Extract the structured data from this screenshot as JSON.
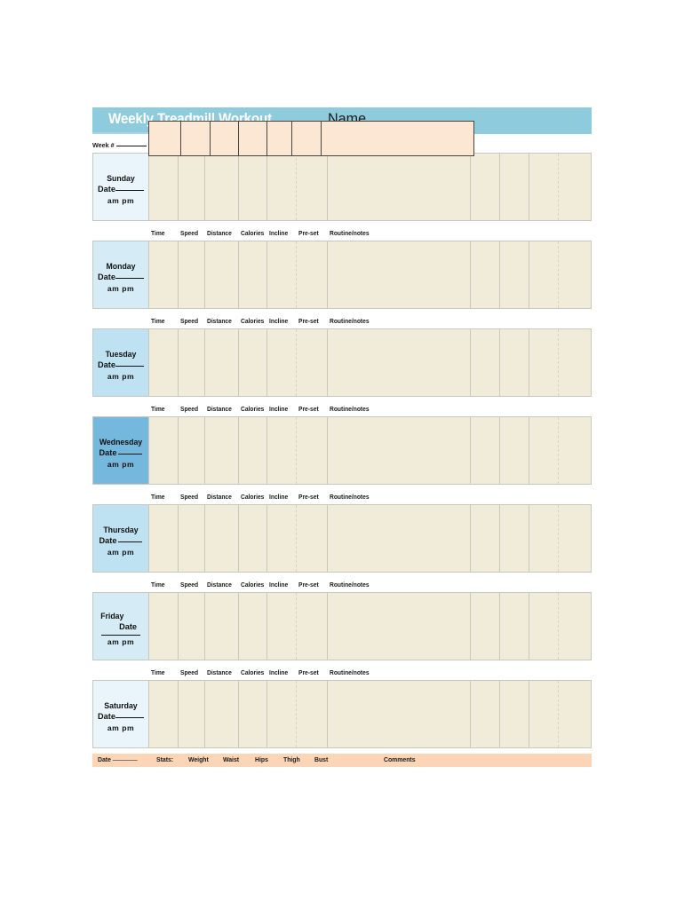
{
  "header": {
    "title": "Weekly Treadmill Workout",
    "name_label": "Name",
    "week_label": "Week #"
  },
  "columns": {
    "time": "Time",
    "speed": "Speed",
    "distance": "Distance",
    "calories": "Calories",
    "incline": "Incline",
    "preset": "Pre-set",
    "routine": "Routine/notes"
  },
  "day_common": {
    "date_label": "Date",
    "ampm_label": "am   pm"
  },
  "days": [
    {
      "name": "Sunday",
      "color": "#e9f5fb"
    },
    {
      "name": "Monday",
      "color": "#d5ecf6"
    },
    {
      "name": "Tuesday",
      "color": "#bfe2f2"
    },
    {
      "name": "Wednesday",
      "color": "#74b9dd"
    },
    {
      "name": "Thursday",
      "color": "#bfe2f2"
    },
    {
      "name": "Friday",
      "color": "#d5ecf6"
    },
    {
      "name": "Saturday",
      "color": "#e9f5fb"
    }
  ],
  "stats": {
    "date_label": "Date",
    "stats_label": "Stats:",
    "weight": "Weight",
    "waist": "Waist",
    "hips": "Hips",
    "thigh": "Thigh",
    "bust": "Bust",
    "comments": "Comments"
  },
  "colors": {
    "header_blue": "#8ecbdd",
    "cell_cream": "#f1ecda",
    "stats_peach": "#fbd5b5",
    "stats_cell": "#fce6d4",
    "grid_line": "#c9c8c0"
  }
}
